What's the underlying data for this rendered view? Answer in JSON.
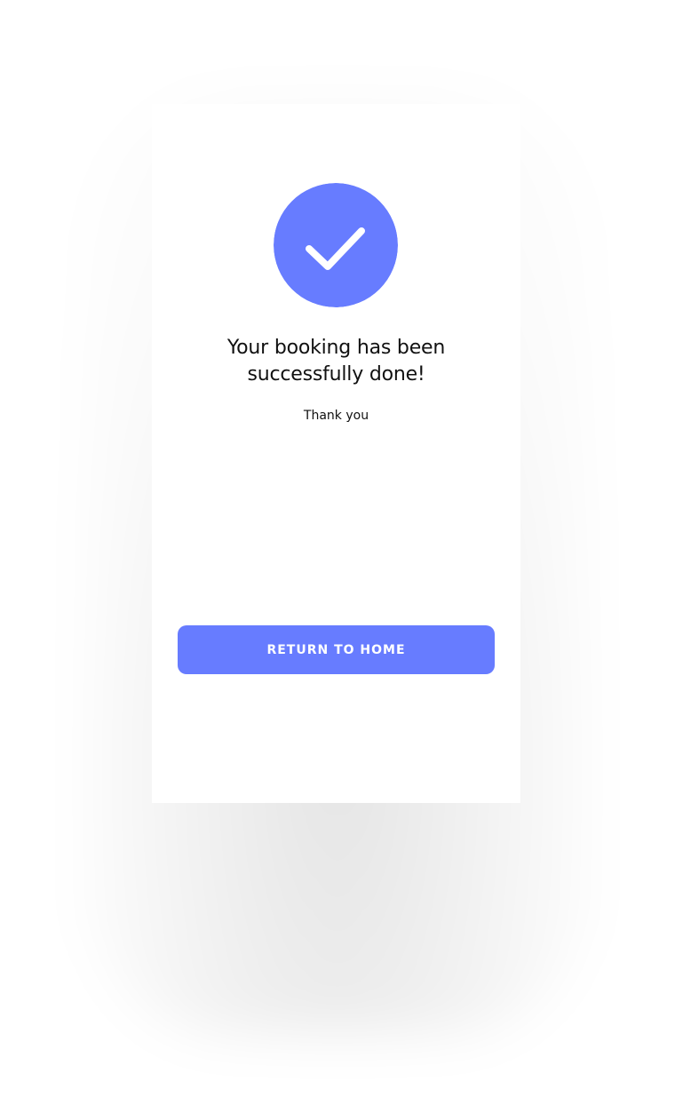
{
  "colors": {
    "accent": "#677cff",
    "background": "#ffffff",
    "text": "#111111",
    "button_text": "#ffffff"
  },
  "confirmation": {
    "icon": "checkmark-icon",
    "title": "Your booking has been\nsuccessfully done!",
    "subtitle": "Thank you"
  },
  "actions": {
    "return_home_label": "RETURN TO HOME"
  }
}
